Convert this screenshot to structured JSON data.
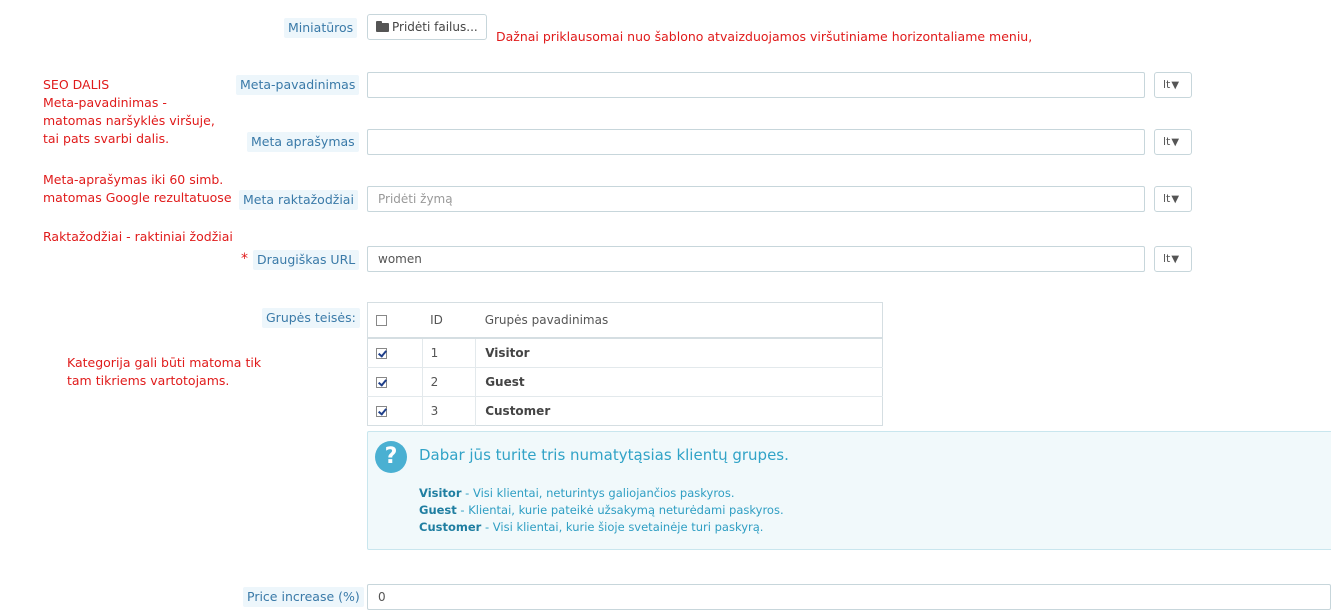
{
  "fields": {
    "thumbnails": {
      "label": "Miniatūros",
      "button_label": "Pridėti failus...",
      "icon": "folder-open-icon"
    },
    "meta_title": {
      "label": "Meta-pavadinimas",
      "value": "",
      "lang": "lt"
    },
    "meta_description": {
      "label": "Meta aprašymas",
      "value": "",
      "lang": "lt"
    },
    "meta_keywords": {
      "label": "Meta raktažodžiai",
      "placeholder": "Pridėti žymą",
      "lang": "lt"
    },
    "friendly_url": {
      "label": "Draugiškas URL",
      "value": "women",
      "lang": "lt",
      "required_mark": "*"
    },
    "group_access": {
      "label": "Grupės teisės:"
    },
    "price_increase": {
      "label": "Price increase (%)",
      "value": "0"
    }
  },
  "group_table": {
    "headers": {
      "id": "ID",
      "name": "Grupės pavadinimas"
    },
    "rows": [
      {
        "id": "1",
        "name": "Visitor",
        "checked": true
      },
      {
        "id": "2",
        "name": "Guest",
        "checked": true
      },
      {
        "id": "3",
        "name": "Customer",
        "checked": true
      }
    ]
  },
  "info_box": {
    "icon": "question-icon",
    "title": "Dabar jūs turite tris numatytąsias klientų grupes.",
    "lines": [
      {
        "name": "Visitor",
        "text": " - Visi klientai, neturintys galiojančios paskyros."
      },
      {
        "name": "Guest",
        "text": " - Klientai, kurie pateikė užsakymą neturėdami paskyros."
      },
      {
        "name": "Customer",
        "text": " - Visi klientai, kurie šioje svetainėje turi paskyrą."
      }
    ]
  },
  "annotations": {
    "thumbnails_note": "Dažnai priklausomai nuo šablono atvaizduojamos viršutiniame horizontaliame meniu,",
    "seo_lines": [
      "SEO DALIS",
      "Meta-pavadinimas -",
      "matomas naršyklės viršuje,",
      "tai pats svarbi dalis."
    ],
    "meta_desc_lines": [
      "Meta-aprašymas iki 60 simb.",
      "matomas Google rezultatuose"
    ],
    "keywords_line": "Raktažodžiai - raktiniai žodžiai",
    "category_lines": [
      "Kategorija gali būti matoma tik",
      "tam tikriems vartotojams."
    ]
  },
  "colors": {
    "annotation": "#e01b1b",
    "label_bg": "#edf6fb",
    "label_text": "#3a7aa8",
    "info_text": "#2f9ec3"
  }
}
